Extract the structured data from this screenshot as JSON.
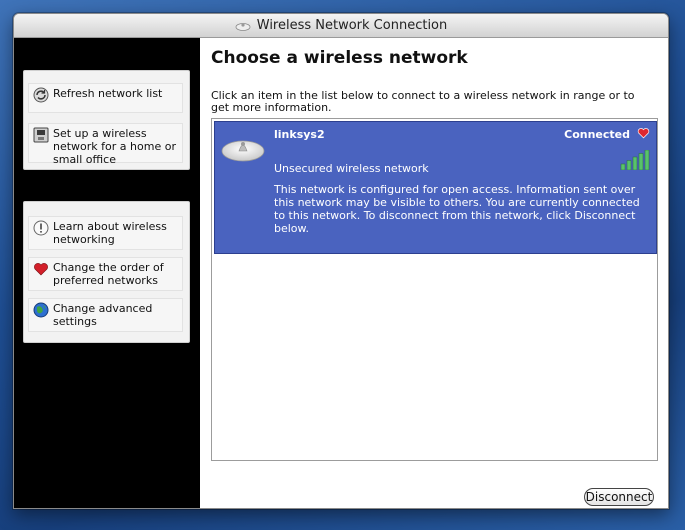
{
  "window": {
    "title": "Wireless Network Connection"
  },
  "sidebar": {
    "network_tasks": [
      {
        "label": "Refresh network list",
        "icon": "refresh-icon"
      },
      {
        "label": "Set up a wireless network for a home or small office",
        "icon": "setup-network-icon"
      }
    ],
    "related_tasks": [
      {
        "label": "Learn about wireless networking",
        "icon": "info-icon"
      },
      {
        "label": "Change the order of preferred networks",
        "icon": "heart-icon"
      },
      {
        "label": "Change advanced settings",
        "icon": "globe-icon"
      }
    ]
  },
  "main": {
    "heading": "Choose a wireless network",
    "instructions": "Click an item in the list below to connect to a wireless network in range or to get more information.",
    "networks": [
      {
        "name": "linksys2",
        "status": "Connected",
        "security": "Unsecured wireless network",
        "description": "This network is configured for open access. Information sent over this network may be visible to others. You are currently connected to this network. To disconnect from this network, click Disconnect below.",
        "signal_bars": 5,
        "signal_max": 5,
        "selected": true
      }
    ],
    "disconnect_label": "Disconnect"
  },
  "colors": {
    "selection": "#4a63bf",
    "sidebar": "#000000",
    "desktop": "#2a5fa6",
    "signal": "#58c26a"
  }
}
